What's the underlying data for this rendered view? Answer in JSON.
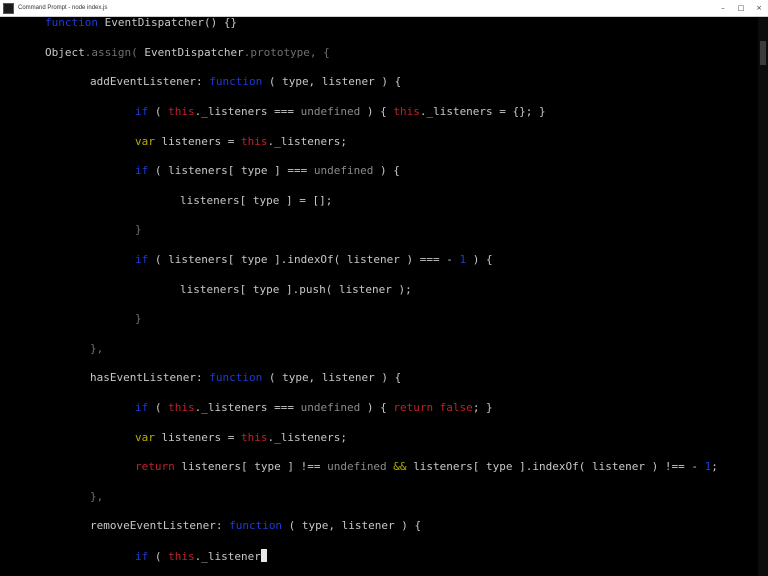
{
  "window": {
    "title": "Command Prompt - node index.js",
    "controls": {
      "minimize": "–",
      "maximize": "□",
      "close": "×"
    }
  },
  "code": {
    "l1": {
      "t1": "function",
      "t2": " EventDispatcher() {}"
    },
    "l2": {
      "t1": "Object",
      "t2": ".assign( ",
      "t3": "EventDispatcher",
      "t4": ".prototype, {"
    },
    "l3": {
      "t1": "addEventListener: ",
      "t2": "function",
      "t3": " ( type, listener ) {"
    },
    "l4": {
      "t1": "if",
      "t2": " ( ",
      "t3": "this",
      "t4": "._listeners === ",
      "t5": "undefined",
      "t6": " ) { ",
      "t7": "this",
      "t8": "._listeners = {}; }"
    },
    "l5": {
      "t1": "var",
      "t2": " listeners = ",
      "t3": "this",
      "t4": "._listeners;"
    },
    "l6": {
      "t1": "if",
      "t2": " ( listeners[ type ] === ",
      "t3": "undefined",
      "t4": " ) {"
    },
    "l7": {
      "t1": "listeners[ type ] = [];"
    },
    "l8": {
      "t1": "}"
    },
    "l9": {
      "t1": "if",
      "t2": " ( listeners[ type ].indexOf( listener ) === - ",
      "t3": "1",
      "t4": " ) {"
    },
    "l10": {
      "t1": "listeners[ type ].push( listener );"
    },
    "l11": {
      "t1": "}"
    },
    "l12": {
      "t1": "},"
    },
    "l13": {
      "t1": "hasEventListener: ",
      "t2": "function",
      "t3": " ( type, listener ) {"
    },
    "l14": {
      "t1": "if",
      "t2": " ( ",
      "t3": "this",
      "t4": "._listeners === ",
      "t5": "undefined",
      "t6": " ) { ",
      "t7": "return false",
      "t8": "; }"
    },
    "l15": {
      "t1": "var",
      "t2": " listeners = ",
      "t3": "this",
      "t4": "._listeners;"
    },
    "l16": {
      "t1": "return",
      "t2": " listeners[ type ] !== ",
      "t3": "undefined",
      "t4": " && ",
      "t5": "listeners[ type ].indexOf( listener ) !== - ",
      "t6": "1",
      "t7": ";"
    },
    "l17": {
      "t1": "},"
    },
    "l18": {
      "t1": "removeEventListener: ",
      "t2": "function",
      "t3": " ( type, listener ) {"
    },
    "l19": {
      "t1": "if",
      "t2": " ( ",
      "t3": "this",
      "t4": "._listener"
    }
  },
  "colors": {
    "background": "#000000",
    "keyword": "#1c3bd6",
    "this_keyword": "#c0202a",
    "plain_text": "#c8c8c8",
    "undefined_text": "#8a8a8a"
  }
}
